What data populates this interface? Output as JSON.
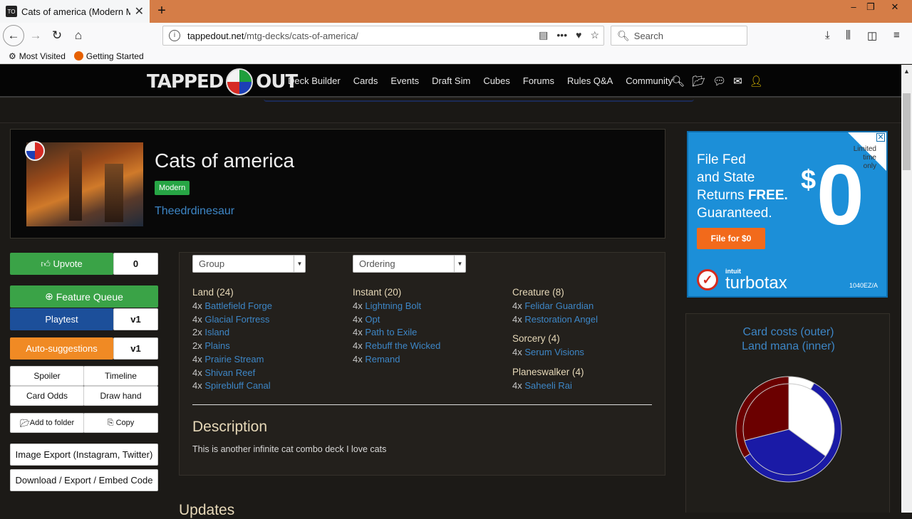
{
  "browser": {
    "tab_title": "Cats of america (Modern MTG",
    "url_host": "tappedout.net",
    "url_path": "/mtg-decks/cats-of-america/",
    "search_placeholder": "Search",
    "bookmarks": [
      "Most Visited",
      "Getting Started"
    ]
  },
  "site": {
    "logo_left": "TAPPED",
    "logo_right": "OUT",
    "nav": [
      "Deck Builder",
      "Cards",
      "Events",
      "Draft Sim",
      "Cubes",
      "Forums",
      "Rules Q&A",
      "Community"
    ]
  },
  "deck": {
    "title": "Cats of america",
    "format": "Modern",
    "author": "Theedrdinesaur"
  },
  "actions": {
    "upvote_label": "Upvote",
    "upvote_count": "0",
    "feature_queue": "Feature Queue",
    "playtest": "Playtest",
    "playtest_version": "v1",
    "auto_suggestions": "Auto-suggestions",
    "auto_version": "v1",
    "spoiler": "Spoiler",
    "timeline": "Timeline",
    "card_odds": "Card Odds",
    "draw_hand": "Draw hand",
    "add_to_folder": "Add to folder",
    "copy": "Copy",
    "image_export": "Image Export (Instagram, Twitter)",
    "download": "Download / Export / Embed Code"
  },
  "controls": {
    "group": "Group",
    "ordering": "Ordering"
  },
  "decklist": {
    "land": {
      "header": "Land (24)",
      "cards": [
        {
          "qty": "4x",
          "name": "Battlefield Forge"
        },
        {
          "qty": "4x",
          "name": "Glacial Fortress"
        },
        {
          "qty": "2x",
          "name": "Island"
        },
        {
          "qty": "2x",
          "name": "Plains"
        },
        {
          "qty": "4x",
          "name": "Prairie Stream"
        },
        {
          "qty": "4x",
          "name": "Shivan Reef"
        },
        {
          "qty": "4x",
          "name": "Spirebluff Canal"
        }
      ]
    },
    "instant": {
      "header": "Instant (20)",
      "cards": [
        {
          "qty": "4x",
          "name": "Lightning Bolt"
        },
        {
          "qty": "4x",
          "name": "Opt"
        },
        {
          "qty": "4x",
          "name": "Path to Exile"
        },
        {
          "qty": "4x",
          "name": "Rebuff the Wicked"
        },
        {
          "qty": "4x",
          "name": "Remand"
        }
      ]
    },
    "creature": {
      "header": "Creature (8)",
      "cards": [
        {
          "qty": "4x",
          "name": "Felidar Guardian"
        },
        {
          "qty": "4x",
          "name": "Restoration Angel"
        }
      ]
    },
    "sorcery": {
      "header": "Sorcery (4)",
      "cards": [
        {
          "qty": "4x",
          "name": "Serum Visions"
        }
      ]
    },
    "planeswalker": {
      "header": "Planeswalker (4)",
      "cards": [
        {
          "qty": "4x",
          "name": "Saheeli Rai"
        }
      ]
    }
  },
  "description": {
    "heading": "Description",
    "text": "This is another infinite cat combo deck I love cats"
  },
  "updates_heading": "Updates",
  "ad": {
    "limited": [
      "Limited",
      "time",
      "only"
    ],
    "headline_1": "File Fed",
    "headline_2": "and State",
    "headline_3a": "Returns ",
    "headline_3b": "FREE.",
    "headline_4": "Guaranteed.",
    "dollar": "$",
    "zero": "0",
    "cta": "File for $0",
    "intuit": "intuit",
    "brand": "turbotax",
    "code": "1040EZ/A"
  },
  "chart": {
    "title_1": "Card costs (outer)",
    "title_2": "Land mana (inner)"
  },
  "chart_data": {
    "type": "pie",
    "series": [
      {
        "name": "Card costs (outer)",
        "colors": [
          "#ffffff",
          "#1a1aa6",
          "#6b0000"
        ],
        "values": [
          8,
          58,
          34
        ]
      },
      {
        "name": "Land mana (inner)",
        "colors": [
          "#ffffff",
          "#1a1aa6",
          "#6b0000"
        ],
        "values": [
          35,
          36,
          29
        ]
      }
    ]
  }
}
